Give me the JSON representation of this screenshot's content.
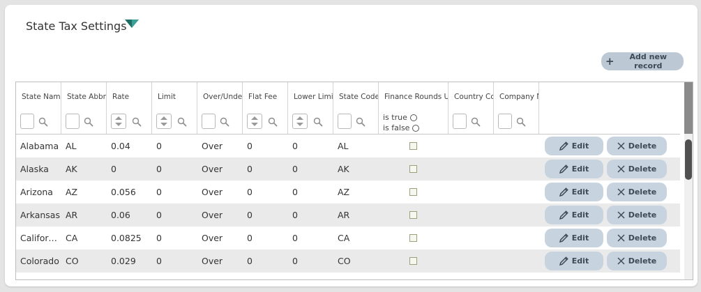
{
  "page": {
    "title": "State Tax Settings",
    "add_button_label": "Add new record"
  },
  "columns": [
    {
      "label": "State Name",
      "filter": "text"
    },
    {
      "label": "State Abbreviation",
      "filter": "text"
    },
    {
      "label": "Rate",
      "filter": "numeric"
    },
    {
      "label": "Limit",
      "filter": "numeric"
    },
    {
      "label": "Over/Under",
      "filter": "text"
    },
    {
      "label": "Flat Fee",
      "filter": "numeric"
    },
    {
      "label": "Lower Limit",
      "filter": "numeric"
    },
    {
      "label": "State Code",
      "filter": "text"
    },
    {
      "label": "Finance Rounds Up",
      "filter": "boolean"
    },
    {
      "label": "Country Code",
      "filter": "text"
    },
    {
      "label": "Company Name",
      "filter": "text"
    }
  ],
  "bool_filter": {
    "true_label": "is true",
    "false_label": "is false"
  },
  "row_actions": {
    "edit_label": "Edit",
    "delete_label": "Delete"
  },
  "rows": [
    {
      "state_name": "Alabama",
      "abbr": "AL",
      "rate": "0.04",
      "limit": "0",
      "over_under": "Over",
      "flat_fee": "0",
      "lower_limit": "0",
      "state_code": "AL",
      "finance_rounds_up": false
    },
    {
      "state_name": "Alaska",
      "abbr": "AK",
      "rate": "0",
      "limit": "0",
      "over_under": "Over",
      "flat_fee": "0",
      "lower_limit": "0",
      "state_code": "AK",
      "finance_rounds_up": false
    },
    {
      "state_name": "Arizona",
      "abbr": "AZ",
      "rate": "0.056",
      "limit": "0",
      "over_under": "Over",
      "flat_fee": "0",
      "lower_limit": "0",
      "state_code": "AZ",
      "finance_rounds_up": false
    },
    {
      "state_name": "Arkansas",
      "abbr": "AR",
      "rate": "0.06",
      "limit": "0",
      "over_under": "Over",
      "flat_fee": "0",
      "lower_limit": "0",
      "state_code": "AR",
      "finance_rounds_up": false
    },
    {
      "state_name": "California",
      "abbr": "CA",
      "rate": "0.0825",
      "limit": "0",
      "over_under": "Over",
      "flat_fee": "0",
      "lower_limit": "0",
      "state_code": "CA",
      "finance_rounds_up": false
    },
    {
      "state_name": "Colorado",
      "abbr": "CO",
      "rate": "0.029",
      "limit": "0",
      "over_under": "Over",
      "flat_fee": "0",
      "lower_limit": "0",
      "state_code": "CO",
      "finance_rounds_up": false
    }
  ],
  "colors": {
    "accent": "#2e8b82",
    "button_bg": "#c7d3df",
    "button_text": "#3d4a57",
    "alt_row": "#eaeaea"
  },
  "icons": {
    "title_toggle": "chevron-down-icon",
    "add": "plus-icon",
    "filter": "search-icon",
    "edit": "pencil-icon",
    "delete": "close-icon"
  }
}
